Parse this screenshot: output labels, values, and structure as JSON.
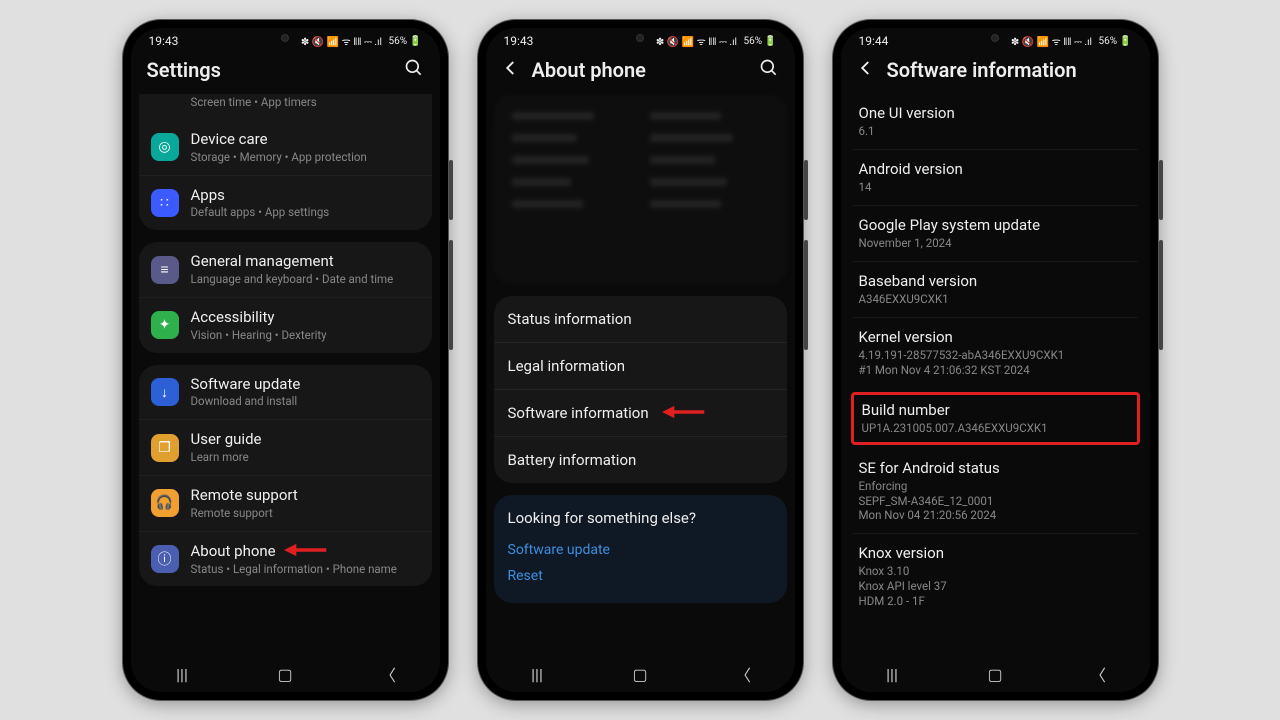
{
  "status": {
    "time1": "19:43",
    "time2": "19:43",
    "time3": "19:44",
    "battery": "56%",
    "icons": "✽ 🔇 📶 ᯤ ‖‖ ⎓ .ıl"
  },
  "phone1": {
    "title": "Settings",
    "partial_sub": "Screen time  •  App timers",
    "rows": [
      {
        "title": "Device care",
        "sub": "Storage  •  Memory  •  App protection",
        "iconBg": "#0aa89a",
        "icon": "◎"
      },
      {
        "title": "Apps",
        "sub": "Default apps  •  App settings",
        "iconBg": "#3b5bff",
        "icon": "∷"
      }
    ],
    "rows2": [
      {
        "title": "General management",
        "sub": "Language and keyboard  •  Date and time",
        "iconBg": "#5a5a8a",
        "icon": "≡"
      },
      {
        "title": "Accessibility",
        "sub": "Vision  •  Hearing  •  Dexterity",
        "iconBg": "#2eb04c",
        "icon": "✦"
      }
    ],
    "rows3": [
      {
        "title": "Software update",
        "sub": "Download and install",
        "iconBg": "#2d5fd6",
        "icon": "↓"
      },
      {
        "title": "User guide",
        "sub": "Learn more",
        "iconBg": "#e0a030",
        "icon": "❐"
      },
      {
        "title": "Remote support",
        "sub": "Remote support",
        "iconBg": "#f0a030",
        "icon": "🎧"
      },
      {
        "title": "About phone",
        "sub": "Status  •  Legal information  •  Phone name",
        "iconBg": "#4b5fb0",
        "icon": "ⓘ"
      }
    ]
  },
  "phone2": {
    "title": "About phone",
    "items": [
      "Status information",
      "Legal information",
      "Software information",
      "Battery information"
    ],
    "looking_title": "Looking for something else?",
    "links": [
      "Software update",
      "Reset"
    ]
  },
  "phone3": {
    "title": "Software information",
    "items": [
      {
        "t": "One UI version",
        "s": [
          "6.1"
        ]
      },
      {
        "t": "Android version",
        "s": [
          "14"
        ]
      },
      {
        "t": "Google Play system update",
        "s": [
          "November 1, 2024"
        ]
      },
      {
        "t": "Baseband version",
        "s": [
          "A346EXXU9CXK1"
        ]
      },
      {
        "t": "Kernel version",
        "s": [
          "4.19.191-28577532-abA346EXXU9CXK1",
          "#1 Mon Nov 4 21:06:32 KST 2024"
        ]
      },
      {
        "t": "Build number",
        "s": [
          "UP1A.231005.007.A346EXXU9CXK1"
        ],
        "highlight": true
      },
      {
        "t": "SE for Android status",
        "s": [
          "Enforcing",
          "SEPF_SM-A346E_12_0001",
          "Mon Nov 04 21:20:56 2024"
        ]
      },
      {
        "t": "Knox version",
        "s": [
          "Knox 3.10",
          "Knox API level 37",
          "HDM 2.0 - 1F"
        ]
      }
    ]
  }
}
